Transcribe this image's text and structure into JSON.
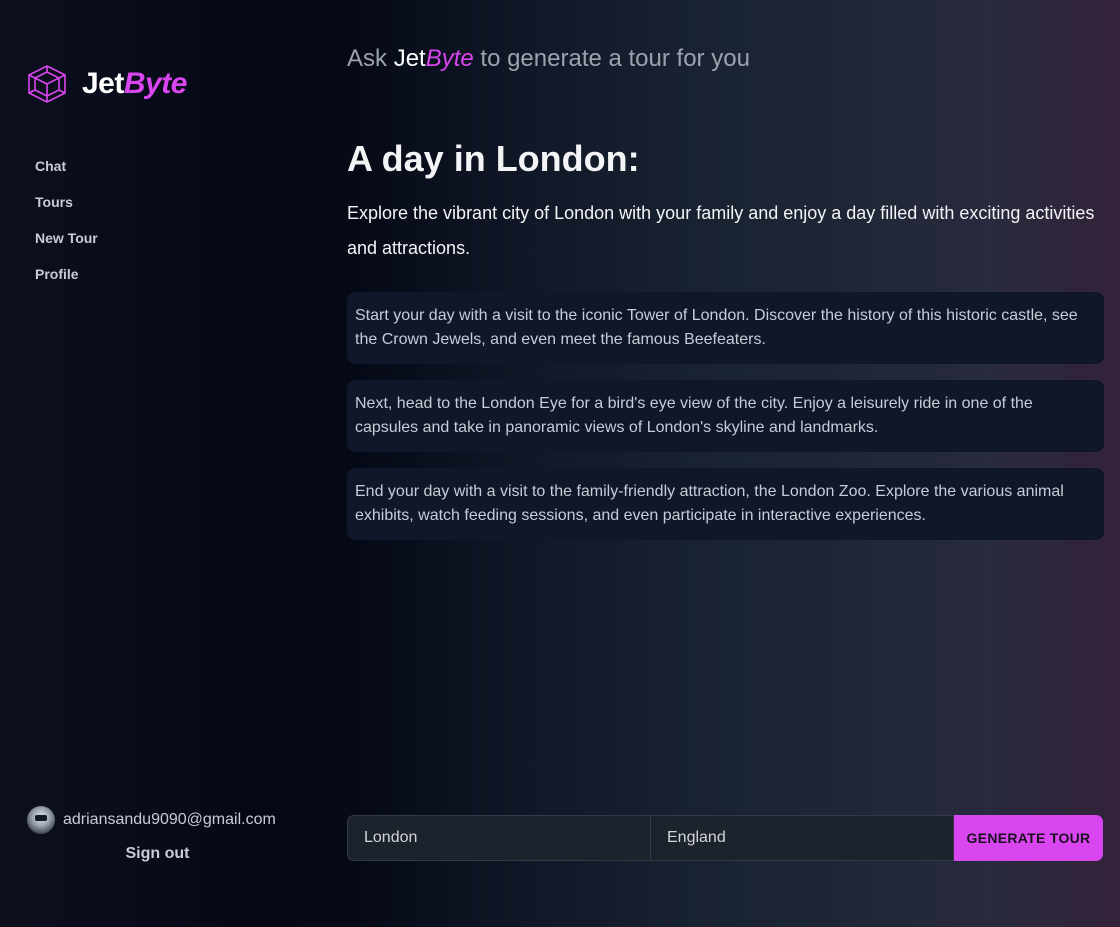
{
  "brand": {
    "logo_icon": "hexagon-cube-icon",
    "name_prefix": "Jet",
    "name_accent": "Byte",
    "accent_color": "#d946ef"
  },
  "sidebar": {
    "nav": [
      {
        "label": "Chat"
      },
      {
        "label": "Tours"
      },
      {
        "label": "New Tour"
      },
      {
        "label": "Profile"
      }
    ],
    "user": {
      "email": "adriansandu9090@gmail.com",
      "avatar_icon": "user-avatar"
    },
    "sign_out_label": "Sign out"
  },
  "header": {
    "ask_prefix": "Ask ",
    "brand_prefix": "Jet",
    "brand_accent": "Byte",
    "ask_suffix": " to generate a tour for you"
  },
  "tour": {
    "title": "A day in London:",
    "description": "Explore the vibrant city of London with your family and enjoy a day filled with exciting activities and attractions.",
    "stops": [
      "Start your day with a visit to the iconic Tower of London. Discover the history of this historic castle, see the Crown Jewels, and even meet the famous Beefeaters.",
      "Next, head to the London Eye for a bird's eye view of the city. Enjoy a leisurely ride in one of the capsules and take in panoramic views of London's skyline and landmarks.",
      "End your day with a visit to the family-friendly attraction, the London Zoo. Explore the various animal exhibits, watch feeding sessions, and even participate in interactive experiences."
    ]
  },
  "form": {
    "city_value": "London",
    "country_value": "England",
    "generate_label": "GENERATE TOUR"
  }
}
